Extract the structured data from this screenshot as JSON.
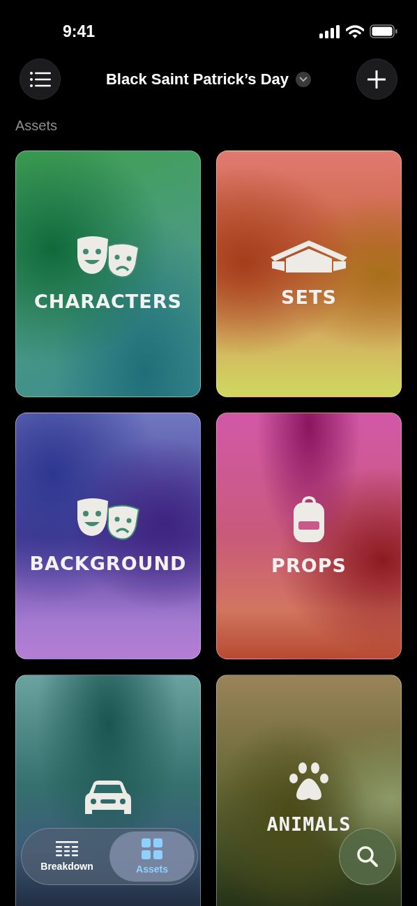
{
  "status_bar": {
    "time": "9:41"
  },
  "header": {
    "title": "Black Saint Patrick’s Day"
  },
  "section_label": "Assets",
  "cards": [
    {
      "kind": "characters",
      "title": "CHARACTERS"
    },
    {
      "kind": "sets",
      "title": "SETS"
    },
    {
      "kind": "background",
      "title": "BACKGROUND"
    },
    {
      "kind": "props",
      "title": "PROPS"
    },
    {
      "kind": "vehicles"
    },
    {
      "kind": "animals",
      "title": "ANIMALS"
    }
  ],
  "tab_bar": [
    {
      "kind": "breakdown",
      "label": "Breakdown",
      "selected": false
    },
    {
      "kind": "assets",
      "label": "Assets",
      "selected": true
    }
  ]
}
